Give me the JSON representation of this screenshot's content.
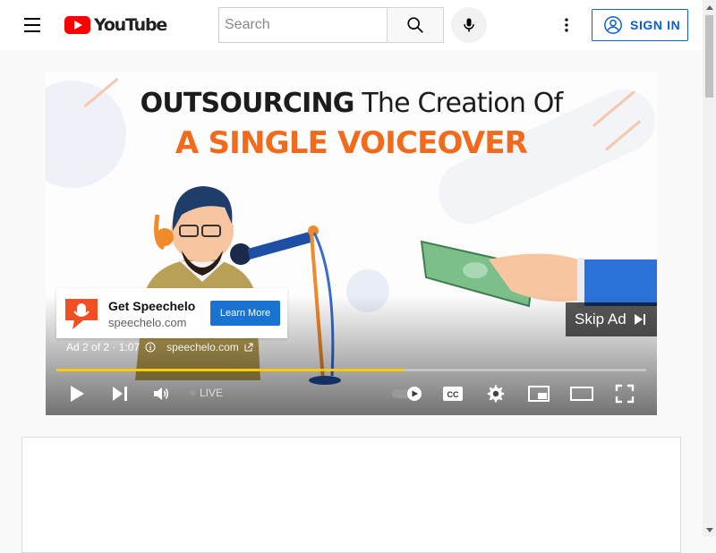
{
  "header": {
    "logo_text": "YouTube",
    "search_placeholder": "Search",
    "signin_label": "SIGN IN"
  },
  "video": {
    "headline_bold": "OUTSOURCING",
    "headline_rest": " The Creation Of",
    "subhead": "A SINGLE VOICEOVER"
  },
  "ad": {
    "title": "Get Speechelo",
    "domain": "speechelo.com",
    "cta": "Learn More",
    "skip_label": "Skip Ad",
    "position": "Ad 2 of 2 · 1:07",
    "link_domain": "speechelo.com",
    "progress": 0.59
  },
  "controls": {
    "live_label": "LIVE"
  },
  "colors": {
    "brand_red": "#ff0000",
    "accent_blue": "#065fd4",
    "progress_yellow": "#ffcc00",
    "headline_orange": "#f26b1d"
  }
}
